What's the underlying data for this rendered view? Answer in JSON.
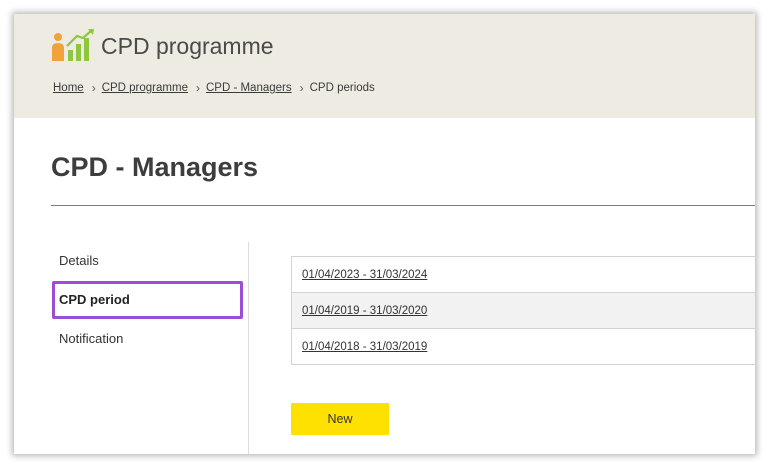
{
  "header": {
    "app_title": "CPD programme",
    "logo_icon": "person-chart-icon",
    "logo_colors": {
      "person": "#f2a23a",
      "bars": "#8ec63f"
    }
  },
  "breadcrumb": {
    "items": [
      "Home",
      "CPD programme",
      "CPD - Managers"
    ],
    "current": "CPD periods",
    "separator": "›"
  },
  "page": {
    "title": "CPD - Managers"
  },
  "sidebar": {
    "items": [
      {
        "label": "Details"
      },
      {
        "label": "CPD period"
      },
      {
        "label": "Notification"
      }
    ],
    "active": "CPD period",
    "highlight_color": "#9b4fd6"
  },
  "periods": {
    "rows": [
      {
        "label": "01/04/2023 - 31/03/2024"
      },
      {
        "label": "01/04/2019 - 31/03/2020"
      },
      {
        "label": "01/04/2018 - 31/03/2019"
      }
    ]
  },
  "actions": {
    "new_label": "New",
    "new_color": "#ffe100"
  }
}
